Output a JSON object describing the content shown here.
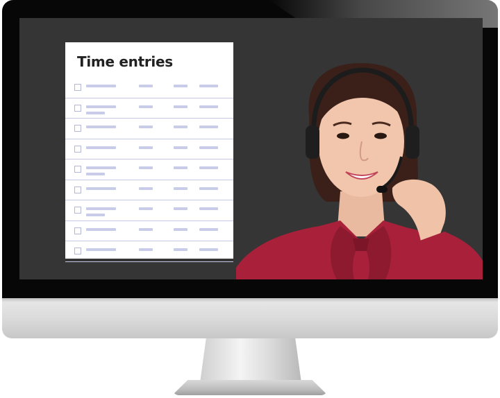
{
  "panel": {
    "title": "Time entries",
    "rows": [
      {
        "two_line_desc": false
      },
      {
        "two_line_desc": true
      },
      {
        "two_line_desc": false
      },
      {
        "two_line_desc": false
      },
      {
        "two_line_desc": true
      },
      {
        "two_line_desc": false
      },
      {
        "two_line_desc": true
      },
      {
        "two_line_desc": false
      },
      {
        "two_line_desc": false
      }
    ]
  },
  "colors": {
    "screen": "#353535",
    "bezel": "#070707",
    "panel_bg": "#ffffff",
    "placeholder": "#c9cce8",
    "shirt": "#a8203a"
  },
  "photo": {
    "subject": "customer-support-agent-with-headset"
  }
}
